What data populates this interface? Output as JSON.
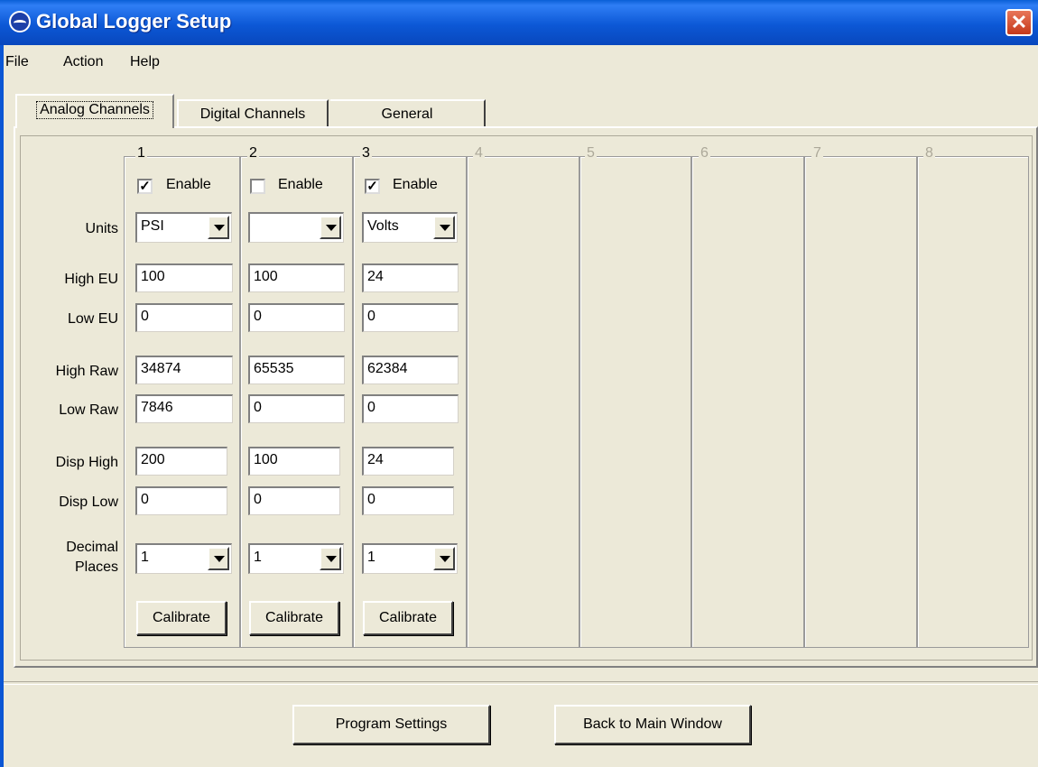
{
  "window": {
    "title": "Global Logger Setup",
    "close_glyph": "✕"
  },
  "menu": [
    "File",
    "Action",
    "Help"
  ],
  "tabs": [
    "Analog Channels",
    "Digital Channels",
    "General"
  ],
  "row_labels": {
    "units": "Units",
    "high_eu": "High EU",
    "low_eu": "Low EU",
    "high_raw": "High Raw",
    "low_raw": "Low Raw",
    "disp_high": "Disp High",
    "disp_low": "Disp Low",
    "decimal_1": "Decimal",
    "decimal_2": "Places"
  },
  "channels": [
    {
      "label": "1",
      "enable_label": "Enable",
      "enabled": true,
      "check": "✓",
      "units": "PSI",
      "high_eu": "100",
      "low_eu": "0",
      "high_raw": "34874",
      "low_raw": "7846",
      "disp_high": "200",
      "disp_low": "0",
      "decimal_places": "1",
      "calibrate": "Calibrate"
    },
    {
      "label": "2",
      "enable_label": "Enable",
      "enabled": false,
      "check": "",
      "units": "",
      "high_eu": "100",
      "low_eu": "0",
      "high_raw": "65535",
      "low_raw": "0",
      "disp_high": "100",
      "disp_low": "0",
      "decimal_places": "1",
      "calibrate": "Calibrate"
    },
    {
      "label": "3",
      "enable_label": "Enable",
      "enabled": true,
      "check": "✓",
      "units": "Volts",
      "high_eu": "24",
      "low_eu": "0",
      "high_raw": "62384",
      "low_raw": "0",
      "disp_high": "24",
      "disp_low": "0",
      "decimal_places": "1",
      "calibrate": "Calibrate"
    }
  ],
  "disabled_channels": [
    "4",
    "5",
    "6",
    "7",
    "8"
  ],
  "buttons": {
    "program_settings": "Program Settings",
    "back_to_main": "Back to Main Window"
  }
}
